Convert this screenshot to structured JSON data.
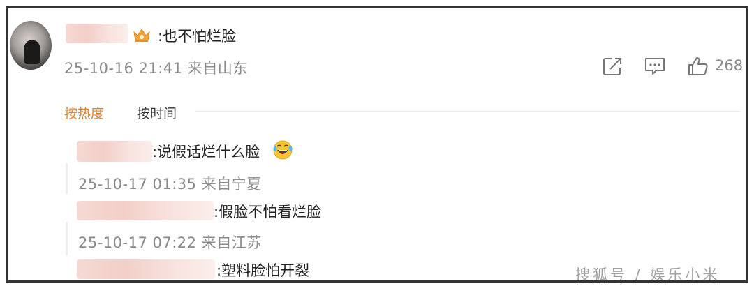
{
  "comment": {
    "text": ":也不怕烂脸",
    "timestamp": "25-10-16 21:41",
    "location": "来自山东",
    "like_count": "268",
    "badge_icon": "crown-vip-icon"
  },
  "actions": {
    "share_icon": "share-icon",
    "reply_icon": "comment-icon",
    "like_icon": "thumbs-up-icon"
  },
  "sort": {
    "hot_label": "按热度",
    "time_label": "按时间",
    "active_color": "#e0802f"
  },
  "replies": [
    {
      "text": ":说假话烂什么脸",
      "timestamp": "25-10-17 01:35",
      "location": "来自宁夏",
      "emoji": "grinning-tears-emoji"
    },
    {
      "text": ":假脸不怕看烂脸",
      "timestamp": "25-10-17 07:22",
      "location": "来自江苏"
    },
    {
      "text": ":塑料脸怕开裂"
    }
  ],
  "watermark": {
    "text": "搜狐号 / 娱乐小米"
  }
}
